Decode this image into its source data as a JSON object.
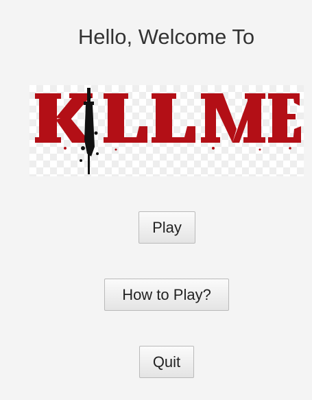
{
  "header": {
    "welcome_text": "Hello, Welcome To"
  },
  "logo": {
    "text": "KILL ME",
    "text_color": "#b30f16",
    "knife_color": "#111111",
    "background": "transparent-checkerboard"
  },
  "menu": {
    "play_label": "Play",
    "how_to_play_label": "How to Play?",
    "quit_label": "Quit"
  }
}
